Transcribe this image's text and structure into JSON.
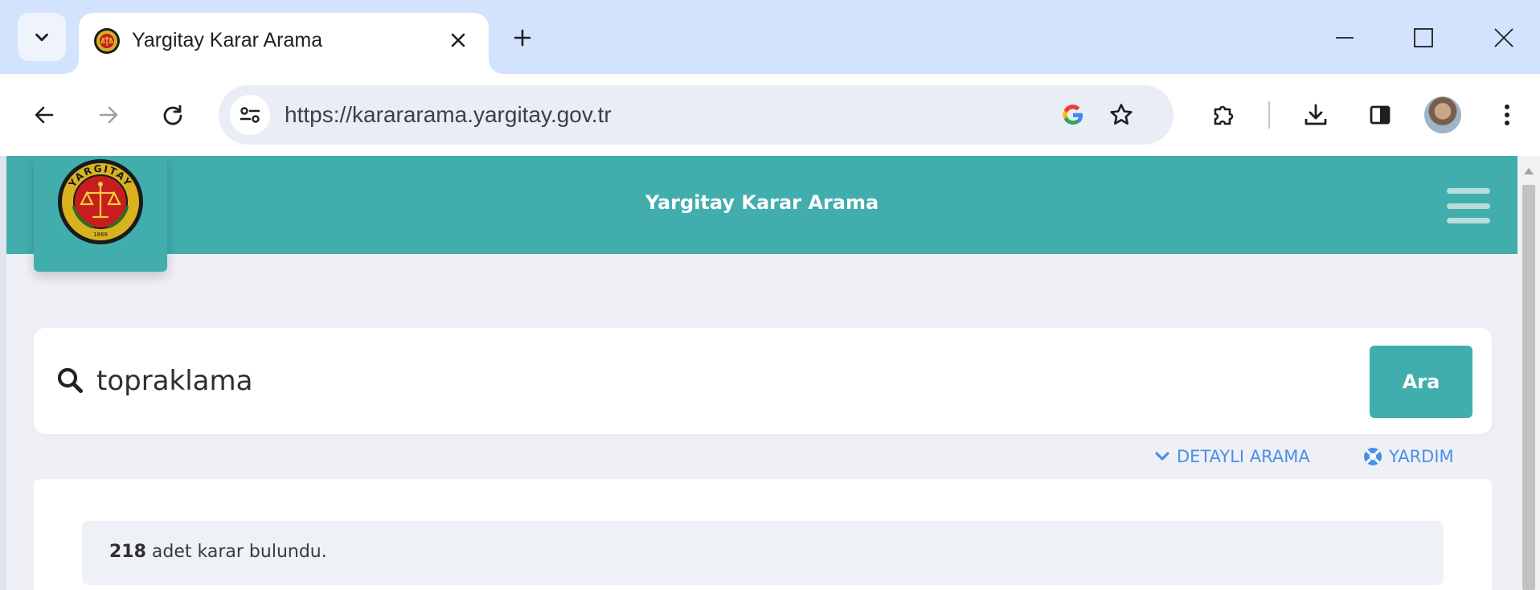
{
  "browser": {
    "tab": {
      "title": "Yargitay Karar Arama",
      "favicon": "yargitay-seal-icon"
    },
    "address": {
      "url": "https://karararama.yargitay.gov.tr"
    },
    "icons": [
      "tab-search-icon",
      "close-icon",
      "new-tab-icon",
      "minimize-icon",
      "maximize-icon",
      "window-close-icon",
      "back-icon",
      "forward-icon",
      "reload-icon",
      "site-info-icon",
      "google-icon",
      "bookmark-star-icon",
      "extensions-icon",
      "download-icon",
      "side-panel-icon",
      "profile-avatar",
      "menu-icon"
    ]
  },
  "header": {
    "title": "Yargitay Karar Arama",
    "color": "#42adad",
    "logo": {
      "ring_text": "YARGITAY",
      "year": "1868"
    }
  },
  "search": {
    "value": "topraklama",
    "button_label": "Ara"
  },
  "links": {
    "detailed": "DETAYLI ARAMA",
    "help": "YARDIM",
    "color": "#4a8fe7"
  },
  "results": {
    "count": "218",
    "suffix": " adet karar bulundu."
  }
}
